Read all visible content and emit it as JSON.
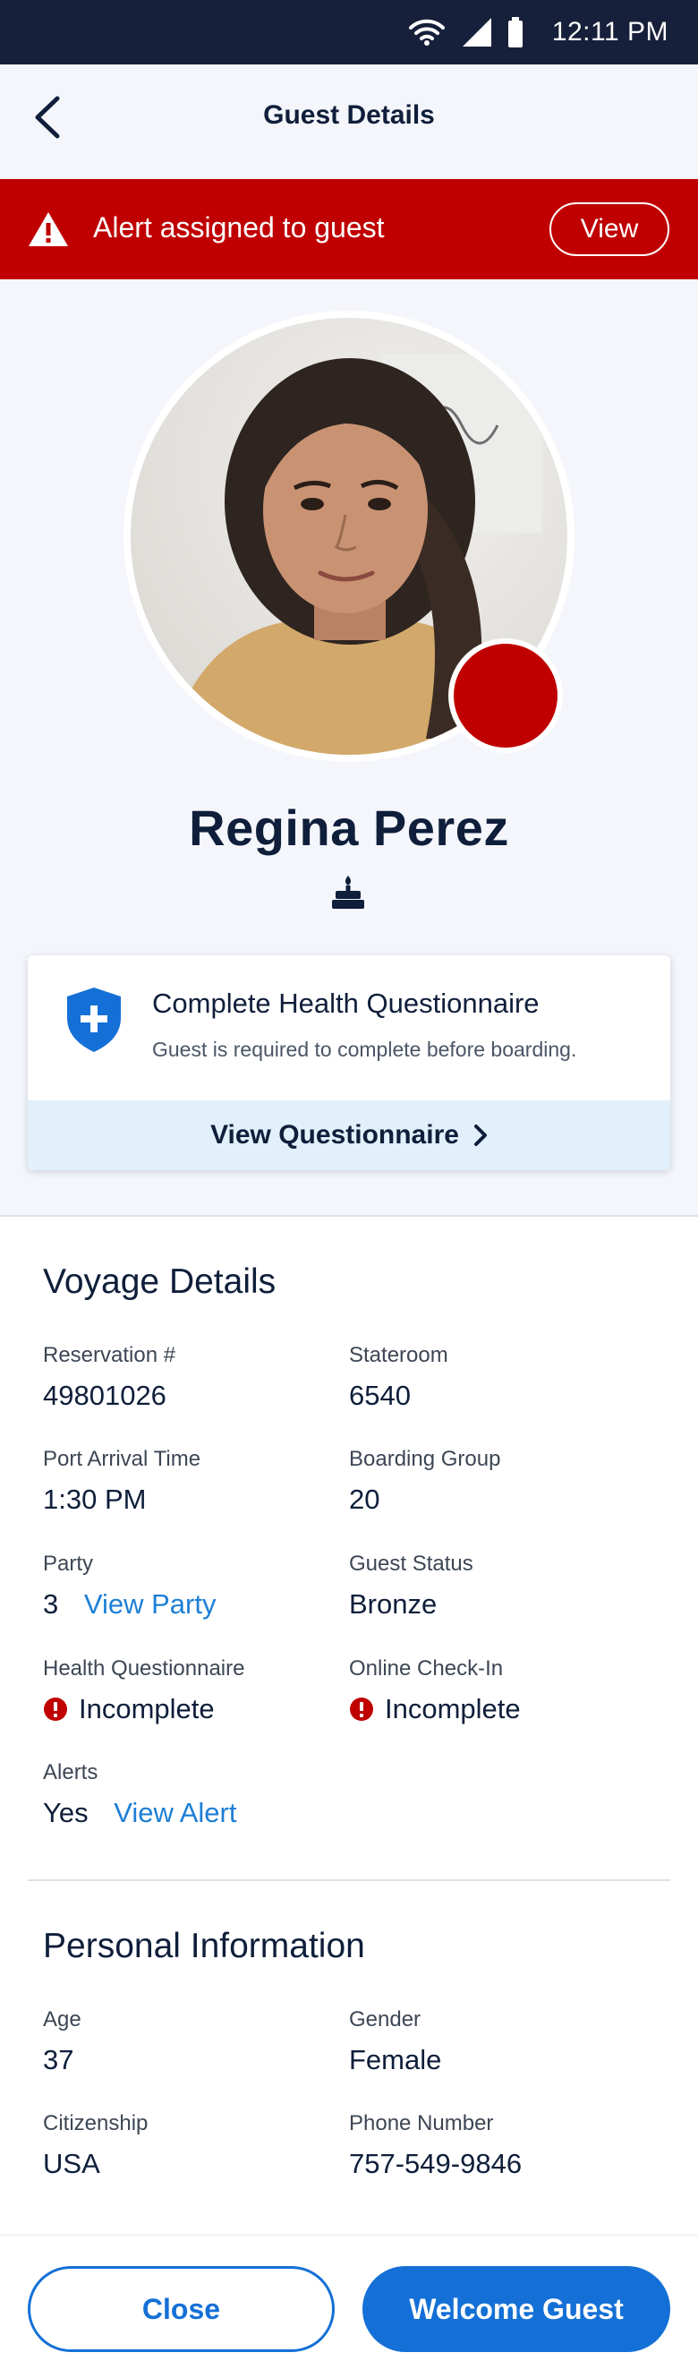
{
  "status_bar": {
    "time": "12:11 PM"
  },
  "header": {
    "title": "Guest Details"
  },
  "alert": {
    "text": "Alert assigned to guest",
    "view_label": "View"
  },
  "guest": {
    "name": "Regina Perez"
  },
  "health_card": {
    "title": "Complete Health Questionnaire",
    "subtitle": "Guest is required to complete before boarding.",
    "link_label": "View Questionnaire"
  },
  "voyage": {
    "title": "Voyage Details",
    "reservation": {
      "label": "Reservation #",
      "value": "49801026"
    },
    "stateroom": {
      "label": "Stateroom",
      "value": "6540"
    },
    "port_arrival": {
      "label": "Port Arrival Time",
      "value": "1:30 PM"
    },
    "boarding_group": {
      "label": "Boarding Group",
      "value": "20"
    },
    "party": {
      "label": "Party",
      "value": "3",
      "link": "View Party"
    },
    "guest_status": {
      "label": "Guest Status",
      "value": "Bronze"
    },
    "health_questionnaire": {
      "label": "Health Questionnaire",
      "value": "Incomplete"
    },
    "online_checkin": {
      "label": "Online Check-In",
      "value": "Incomplete"
    },
    "alerts": {
      "label": "Alerts",
      "value": "Yes",
      "link": "View Alert"
    }
  },
  "personal": {
    "title": "Personal Information",
    "age": {
      "label": "Age",
      "value": "37"
    },
    "gender": {
      "label": "Gender",
      "value": "Female"
    },
    "citizenship": {
      "label": "Citizenship",
      "value": "USA"
    },
    "phone": {
      "label": "Phone Number",
      "value": "757-549-9846"
    }
  },
  "footer": {
    "close_label": "Close",
    "welcome_label": "Welcome Guest"
  },
  "colors": {
    "alert_red": "#c00000",
    "primary_blue": "#1470d6",
    "link_blue": "#1d7fd6",
    "navy": "#0f1e3a",
    "light_bg": "#f4f6fb",
    "card_link_bg": "#e1f0fa"
  },
  "icons": [
    "wifi-icon",
    "cellular-icon",
    "battery-icon",
    "back-arrow-icon",
    "warning-icon",
    "birthday-cake-icon",
    "shield-plus-icon",
    "chevron-right-icon",
    "error-circle-icon"
  ]
}
